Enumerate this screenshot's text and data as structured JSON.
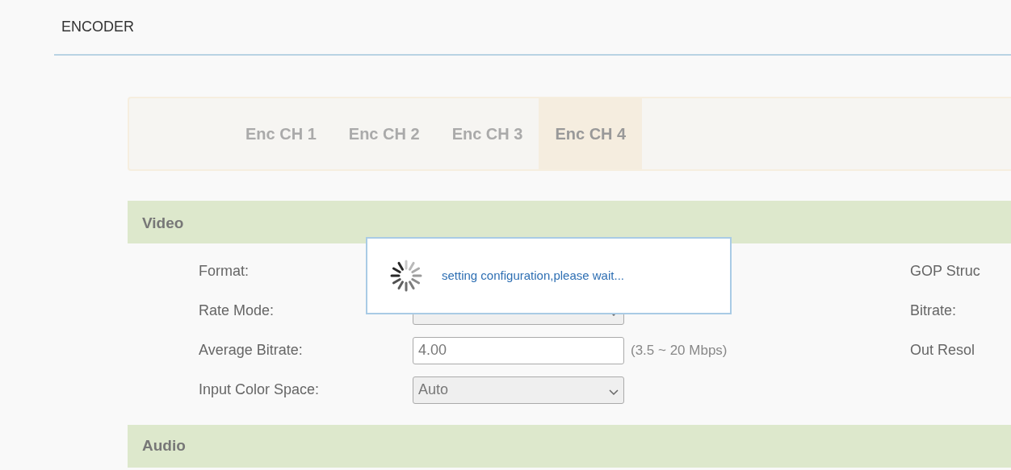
{
  "header": {
    "title": "ENCODER"
  },
  "tabs": [
    {
      "label": "Enc CH 1",
      "selected": false
    },
    {
      "label": "Enc CH 2",
      "selected": false
    },
    {
      "label": "Enc CH 3",
      "selected": false
    },
    {
      "label": "Enc CH 4",
      "selected": true
    }
  ],
  "video": {
    "title": "Video",
    "left_fields": [
      {
        "label": "Format:",
        "kind": "hidden"
      },
      {
        "label": "Rate Mode:",
        "kind": "select"
      },
      {
        "label": "Average Bitrate:",
        "kind": "input",
        "value": "4.00",
        "hint": "(3.5 ~ 20 Mbps)"
      },
      {
        "label": "Input Color Space:",
        "kind": "select",
        "value": "Auto"
      }
    ],
    "right_fields": [
      {
        "label": "GOP Struc"
      },
      {
        "label": "Bitrate:"
      },
      {
        "label": "Out Resol"
      }
    ]
  },
  "audio": {
    "title": "Audio"
  },
  "dialog": {
    "message": "setting configuration,please wait..."
  }
}
